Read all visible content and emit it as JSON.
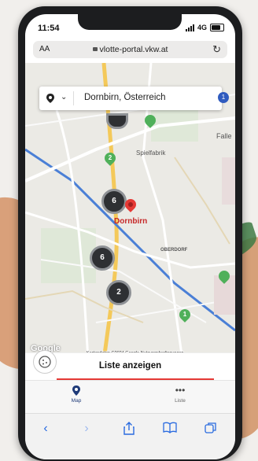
{
  "status": {
    "time": "11:54",
    "network": "4G"
  },
  "browser": {
    "text_size": "AA",
    "url": "vlotte-portal.vkw.at"
  },
  "location": {
    "value": "Dornbirn, Österreich",
    "notification_count": "1"
  },
  "map": {
    "labels": [
      "Spielfabrik",
      "Falle",
      "Dornbirn",
      "OBERDORF"
    ],
    "clusters": [
      "6",
      "6",
      "2"
    ],
    "stations": [
      "2",
      "1"
    ],
    "attribution": "Kartendaten ©2024 Google   Nutzungsbedingungen",
    "logo": "Google"
  },
  "list_button": "Liste anzeigen",
  "tabs": [
    {
      "label": "Map",
      "icon": "map-pin-icon",
      "active": true
    },
    {
      "label": "Liste",
      "icon": "more-dots-icon",
      "active": false
    }
  ],
  "colors": {
    "accent": "#e53935",
    "station": "#4fb05a",
    "cluster": "#2e3033",
    "ios_blue": "#2a6be0"
  }
}
